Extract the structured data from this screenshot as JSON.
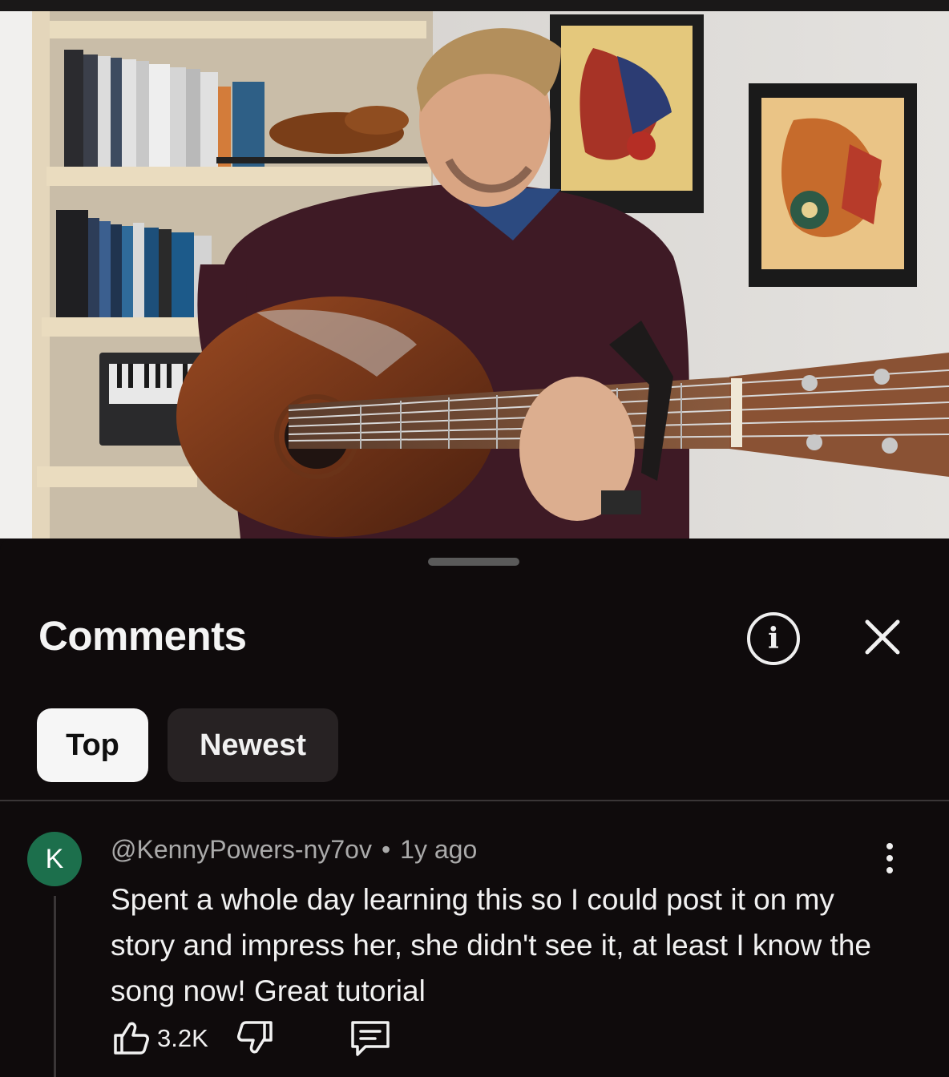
{
  "sheet": {
    "title": "Comments",
    "info_icon": "info-icon",
    "close_icon": "close-icon"
  },
  "tabs": [
    {
      "label": "Top",
      "active": true
    },
    {
      "label": "Newest",
      "active": false
    }
  ],
  "comment": {
    "avatar_letter": "K",
    "author": "@KennyPowers-ny7ov",
    "separator": "•",
    "time": "1y ago",
    "text": "Spent a whole day learning this so I could post it on my story and impress her, she didn't see it, at least I know the song now! Great tutorial",
    "likes": "3.2K"
  },
  "colors": {
    "background": "#0f0b0c",
    "avatar": "#1c6f4c",
    "chip_active": "#f6f6f6",
    "chip_inactive": "#272223"
  }
}
